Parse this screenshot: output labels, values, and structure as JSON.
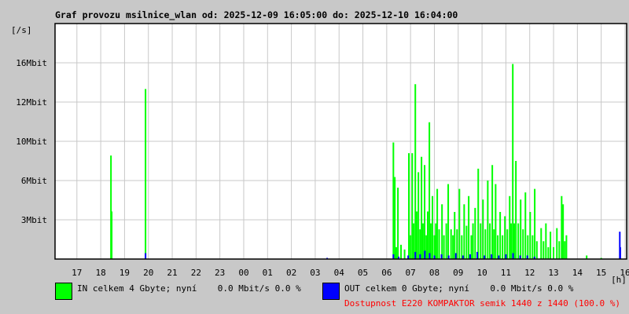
{
  "chart_data": {
    "type": "bar",
    "title": "Graf provozu msilnice_wlan od: 2025-12-09 16:05:00 do: 2025-12-10 16:04:00",
    "ylabel": "[/s]",
    "xlabel": "[h]",
    "x_unit": "hours since 2025-12-09 00:00",
    "xlim": [
      16.083,
      40.067
    ],
    "ylim": [
      0,
      19.8
    ],
    "y_ticks": [
      {
        "value": 3.3,
        "label": "3Mbit"
      },
      {
        "value": 6.6,
        "label": "6Mbit"
      },
      {
        "value": 9.9,
        "label": "10Mbit"
      },
      {
        "value": 13.2,
        "label": "12Mbit"
      },
      {
        "value": 16.5,
        "label": "16Mbit"
      }
    ],
    "x_ticks": [
      {
        "value": 17,
        "label": "17"
      },
      {
        "value": 18,
        "label": "18"
      },
      {
        "value": 19,
        "label": "19"
      },
      {
        "value": 20,
        "label": "20"
      },
      {
        "value": 21,
        "label": "21"
      },
      {
        "value": 22,
        "label": "22"
      },
      {
        "value": 23,
        "label": "23"
      },
      {
        "value": 24,
        "label": "00"
      },
      {
        "value": 25,
        "label": "01"
      },
      {
        "value": 26,
        "label": "02"
      },
      {
        "value": 27,
        "label": "03"
      },
      {
        "value": 28,
        "label": "04"
      },
      {
        "value": 29,
        "label": "05"
      },
      {
        "value": 30,
        "label": "06"
      },
      {
        "value": 31,
        "label": "07"
      },
      {
        "value": 32,
        "label": "08"
      },
      {
        "value": 33,
        "label": "09"
      },
      {
        "value": 34,
        "label": "10"
      },
      {
        "value": 35,
        "label": "11"
      },
      {
        "value": 36,
        "label": "12"
      },
      {
        "value": 37,
        "label": "13"
      },
      {
        "value": 38,
        "label": "14"
      },
      {
        "value": 39,
        "label": "15"
      },
      {
        "value": 40,
        "label": "16"
      }
    ],
    "grid": true,
    "series": [
      {
        "name": "IN",
        "color": "#00ff00",
        "points": [
          [
            18.43,
            8.7
          ],
          [
            18.46,
            4.0
          ],
          [
            19.88,
            14.3
          ],
          [
            30.28,
            9.8
          ],
          [
            30.34,
            6.9
          ],
          [
            30.4,
            1.0
          ],
          [
            30.47,
            6.0
          ],
          [
            30.6,
            1.2
          ],
          [
            30.75,
            0.8
          ],
          [
            30.93,
            8.9
          ],
          [
            31.0,
            2.0
          ],
          [
            31.07,
            8.9
          ],
          [
            31.13,
            3.0
          ],
          [
            31.2,
            14.7
          ],
          [
            31.26,
            4.0
          ],
          [
            31.33,
            7.3
          ],
          [
            31.4,
            2.5
          ],
          [
            31.46,
            8.6
          ],
          [
            31.52,
            3.0
          ],
          [
            31.59,
            7.9
          ],
          [
            31.66,
            2.0
          ],
          [
            31.72,
            4.0
          ],
          [
            31.79,
            11.5
          ],
          [
            31.85,
            3.0
          ],
          [
            31.92,
            5.3
          ],
          [
            32.0,
            2.0
          ],
          [
            32.06,
            3.0
          ],
          [
            32.12,
            5.9
          ],
          [
            32.2,
            2.5
          ],
          [
            32.32,
            4.6
          ],
          [
            32.4,
            2.0
          ],
          [
            32.5,
            3.0
          ],
          [
            32.58,
            6.3
          ],
          [
            32.7,
            2.5
          ],
          [
            32.78,
            2.0
          ],
          [
            32.85,
            3.96
          ],
          [
            32.95,
            2.5
          ],
          [
            33.05,
            5.9
          ],
          [
            33.15,
            2.0
          ],
          [
            33.25,
            4.6
          ],
          [
            33.35,
            2.8
          ],
          [
            33.44,
            5.3
          ],
          [
            33.55,
            2.0
          ],
          [
            33.62,
            3.0
          ],
          [
            33.71,
            4.3
          ],
          [
            33.84,
            7.6
          ],
          [
            33.94,
            3.0
          ],
          [
            34.04,
            5.0
          ],
          [
            34.14,
            2.5
          ],
          [
            34.24,
            6.6
          ],
          [
            34.33,
            3.0
          ],
          [
            34.43,
            7.9
          ],
          [
            34.5,
            2.5
          ],
          [
            34.57,
            6.3
          ],
          [
            34.66,
            2.0
          ],
          [
            34.76,
            3.96
          ],
          [
            34.86,
            2.0
          ],
          [
            34.96,
            3.6
          ],
          [
            35.06,
            2.5
          ],
          [
            35.16,
            5.3
          ],
          [
            35.22,
            3.0
          ],
          [
            35.29,
            16.4
          ],
          [
            35.35,
            3.0
          ],
          [
            35.42,
            8.25
          ],
          [
            35.52,
            3.0
          ],
          [
            35.62,
            5.0
          ],
          [
            35.72,
            2.5
          ],
          [
            35.82,
            5.6
          ],
          [
            35.92,
            2.0
          ],
          [
            36.02,
            3.96
          ],
          [
            36.12,
            2.0
          ],
          [
            36.21,
            5.9
          ],
          [
            36.3,
            1.5
          ],
          [
            36.48,
            2.6
          ],
          [
            36.58,
            1.5
          ],
          [
            36.68,
            3.0
          ],
          [
            36.78,
            1.0
          ],
          [
            36.87,
            2.3
          ],
          [
            37.0,
            1.0
          ],
          [
            37.14,
            2.6
          ],
          [
            37.24,
            1.5
          ],
          [
            37.34,
            5.3
          ],
          [
            37.4,
            4.6
          ],
          [
            37.47,
            1.5
          ],
          [
            37.54,
            2.0
          ],
          [
            38.39,
            0.3
          ],
          [
            39.0,
            0.1
          ]
        ]
      },
      {
        "name": "OUT",
        "color": "#0000ff",
        "points": [
          [
            19.88,
            0.5
          ],
          [
            27.5,
            0.1
          ],
          [
            30.28,
            0.4
          ],
          [
            30.5,
            0.2
          ],
          [
            30.9,
            0.3
          ],
          [
            31.2,
            0.6
          ],
          [
            31.4,
            0.4
          ],
          [
            31.6,
            0.7
          ],
          [
            31.8,
            0.5
          ],
          [
            32.0,
            0.3
          ],
          [
            32.3,
            0.4
          ],
          [
            32.6,
            0.3
          ],
          [
            32.9,
            0.5
          ],
          [
            33.2,
            0.3
          ],
          [
            33.5,
            0.4
          ],
          [
            33.8,
            0.6
          ],
          [
            34.1,
            0.3
          ],
          [
            34.4,
            0.4
          ],
          [
            34.7,
            0.3
          ],
          [
            35.0,
            0.4
          ],
          [
            35.3,
            0.5
          ],
          [
            35.6,
            0.3
          ],
          [
            35.9,
            0.3
          ],
          [
            36.2,
            0.2
          ],
          [
            39.78,
            2.3
          ],
          [
            39.8,
            1.0
          ]
        ]
      }
    ],
    "legend": [
      {
        "label": "IN celkem 4 Gbyte; nyní    0.0 Mbit/s 0.0 %",
        "color": "#00ff00"
      },
      {
        "label": "OUT celkem 0 Gbyte; nyní    0.0 Mbit/s 0.0 %",
        "color": "#0000ff"
      }
    ],
    "annotation": "Dostupnost E220 KOMPAKTOR semik 1440 z 1440 (100.0 %)"
  }
}
